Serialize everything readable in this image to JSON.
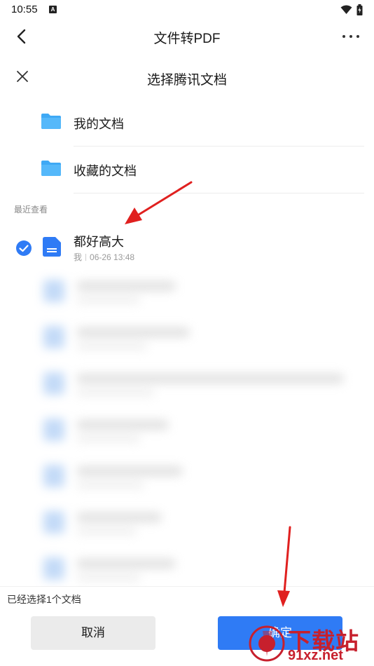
{
  "status_bar": {
    "time": "10:55",
    "notification_glyph": "A",
    "icons": [
      "wifi-icon",
      "battery-icon"
    ]
  },
  "app_header": {
    "title": "文件转PDF",
    "back_icon": "chevron-left-icon",
    "more_icon": "more-horizontal-icon"
  },
  "dialog": {
    "title": "选择腾讯文档",
    "close_icon": "close-icon"
  },
  "folders": [
    {
      "label": "我的文档",
      "icon": "folder-icon"
    },
    {
      "label": "收藏的文档",
      "icon": "folder-icon"
    }
  ],
  "recent": {
    "section_label": "最近查看",
    "items": [
      {
        "name": "都好高大",
        "owner": "我",
        "time": "06-26 13:48",
        "selected": true,
        "icon": "document-icon"
      }
    ]
  },
  "footer": {
    "selected_count_text": "已经选择1个文档",
    "cancel_label": "取消",
    "confirm_label": "确定"
  },
  "watermark": {
    "brand_text": "下载站",
    "url_text": "91xz.net"
  },
  "colors": {
    "accent": "#2f7bf5",
    "folder": "#3fa9f5",
    "annotation": "#e0201f",
    "watermark": "#c7202d"
  }
}
